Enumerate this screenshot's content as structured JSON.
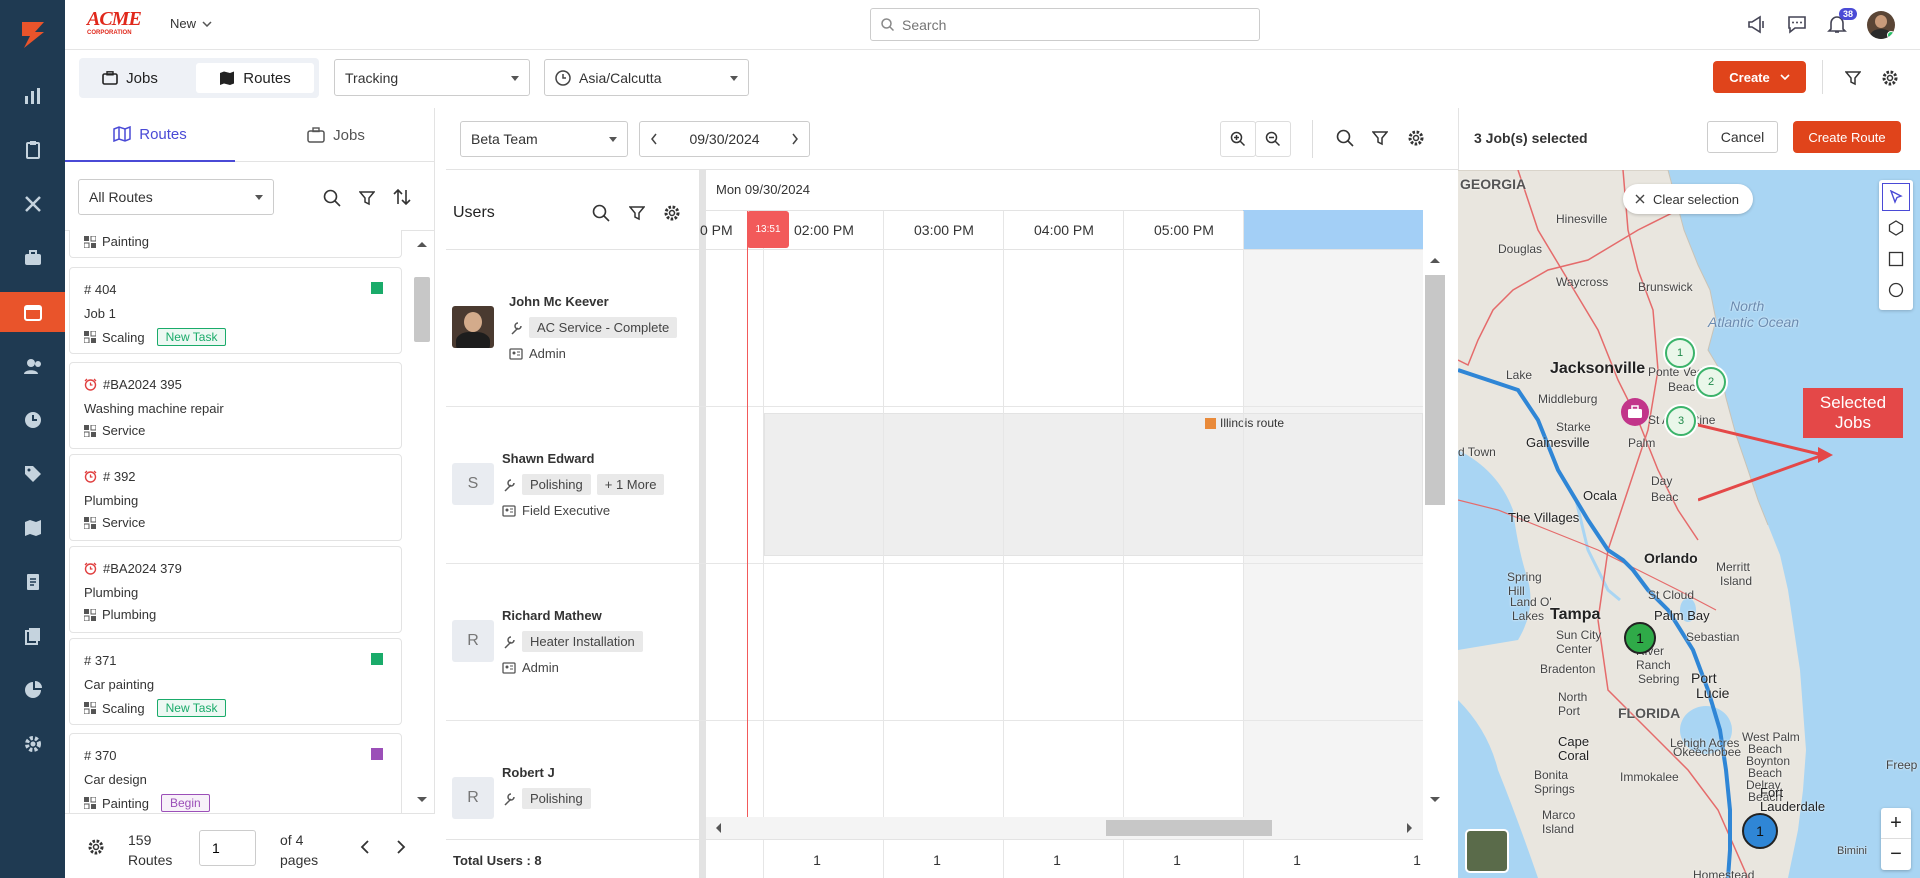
{
  "brand": {
    "logo_text": "ACME",
    "logo_sub": "CORPORATION",
    "new_label": "New"
  },
  "search": {
    "placeholder": "Search"
  },
  "notifications": {
    "count": "38"
  },
  "view_tabs": {
    "jobs": "Jobs",
    "routes": "Routes"
  },
  "tracking_select": "Tracking",
  "timezone_select": "Asia/Calcutta",
  "create_label": "Create",
  "left_panel": {
    "tabs": {
      "routes": "Routes",
      "jobs": "Jobs"
    },
    "filter_select": "All Routes",
    "partial_card_category": "Painting",
    "cards": [
      {
        "id": "# 404",
        "name": "Job 1",
        "category": "Scaling",
        "badge": "New Task",
        "badge_color": "#1aab6a",
        "square_color": "#1aab6a",
        "alarm": false
      },
      {
        "id": "#BA2024 395",
        "name": "Washing machine repair",
        "category": "Service",
        "badge": "",
        "alarm": true
      },
      {
        "id": "# 392",
        "name": "Plumbing",
        "category": "Service",
        "badge": "",
        "alarm": true
      },
      {
        "id": "#BA2024 379",
        "name": "Plumbing",
        "category": "Plumbing",
        "badge": "",
        "alarm": true
      },
      {
        "id": "# 371",
        "name": "Car painting",
        "category": "Scaling",
        "badge": "New Task",
        "badge_color": "#1aab6a",
        "square_color": "#1aab6a",
        "alarm": false
      },
      {
        "id": "# 370",
        "name": "Car design",
        "category": "Painting",
        "badge": "Begin",
        "badge_color": "#9b4fb8",
        "square_color": "#9b4fb8",
        "alarm": false
      }
    ],
    "footer": {
      "count": "159",
      "count_label": "Routes",
      "page_value": "1",
      "of_pages": "of 4",
      "pages_label": "pages"
    }
  },
  "schedule": {
    "team_select": "Beta Team",
    "date": "09/30/2024",
    "day_header": "Mon 09/30/2024",
    "now_marker": "13:51",
    "time_labels": [
      "0 PM",
      "02:00 PM",
      "03:00 PM",
      "04:00 PM",
      "05:00 PM"
    ],
    "users_title": "Users",
    "users": [
      {
        "name": "John Mc Keever",
        "skill": "AC Service - Complete",
        "more": "",
        "role": "Admin",
        "initial": ""
      },
      {
        "name": "Shawn Edward",
        "skill": "Polishing",
        "more": "+ 1 More",
        "role": "Field Executive",
        "initial": "S"
      },
      {
        "name": "Richard Mathew",
        "skill": "Heater Installation",
        "more": "",
        "role": "Admin",
        "initial": "R"
      },
      {
        "name": "Robert J",
        "skill": "Polishing",
        "more": "",
        "role": "",
        "initial": "R"
      }
    ],
    "route_label": "Illinois route",
    "route_color": "#e98a3a",
    "total_users": "Total Users : 8",
    "footer_counts": [
      "1",
      "1",
      "1",
      "1",
      "1",
      "1"
    ]
  },
  "map_panel": {
    "selected_text": "3 Job(s) selected",
    "cancel_label": "Cancel",
    "create_route_label": "Create Route",
    "clear_selection": "Clear selection",
    "callout": "Selected Jobs",
    "markers": [
      "1",
      "2",
      "3"
    ],
    "route_markers": [
      "1",
      "1"
    ],
    "zoom_in": "+",
    "zoom_out": "−",
    "places": [
      {
        "t": "GEORGIA"
      },
      {
        "t": "Hinesville"
      },
      {
        "t": "Douglas"
      },
      {
        "t": "Waycross"
      },
      {
        "t": "Brunswick"
      },
      {
        "t": "North"
      },
      {
        "t": "Atlantic Ocean"
      },
      {
        "t": "Jacksonville"
      },
      {
        "t": "Lake"
      },
      {
        "t": "Ponte Vedra"
      },
      {
        "t": "Beach"
      },
      {
        "t": "Middleburg"
      },
      {
        "t": "St Augustine"
      },
      {
        "t": "Starke"
      },
      {
        "t": "Gainesville"
      },
      {
        "t": "Palm"
      },
      {
        "t": "d Town"
      },
      {
        "t": "Ocala"
      },
      {
        "t": "Day"
      },
      {
        "t": "Beac"
      },
      {
        "t": "The Villages"
      },
      {
        "t": "Orlando"
      },
      {
        "t": "Merritt"
      },
      {
        "t": "Island"
      },
      {
        "t": "Spring"
      },
      {
        "t": "Hill"
      },
      {
        "t": "St Cloud"
      },
      {
        "t": "Land O'"
      },
      {
        "t": "Lakes"
      },
      {
        "t": "Palm Bay"
      },
      {
        "t": "Tampa"
      },
      {
        "t": "Sun City"
      },
      {
        "t": "Center"
      },
      {
        "t": "Sebastian"
      },
      {
        "t": "River"
      },
      {
        "t": "Ranch"
      },
      {
        "t": "Bradenton"
      },
      {
        "t": "Sebring"
      },
      {
        "t": "Port"
      },
      {
        "t": "Lucie"
      },
      {
        "t": "North"
      },
      {
        "t": "Port"
      },
      {
        "t": "FLORIDA"
      },
      {
        "t": "Cape"
      },
      {
        "t": "Coral"
      },
      {
        "t": "Lehigh Acres"
      },
      {
        "t": "Okeechobee"
      },
      {
        "t": "West Palm"
      },
      {
        "t": "Beach"
      },
      {
        "t": "Boynton"
      },
      {
        "t": "Beach"
      },
      {
        "t": "Delray"
      },
      {
        "t": "Beach"
      },
      {
        "t": "Bonita"
      },
      {
        "t": "Springs"
      },
      {
        "t": "Immokalee"
      },
      {
        "t": "Fort"
      },
      {
        "t": "Lauderdale"
      },
      {
        "t": "Marco"
      },
      {
        "t": "Island"
      },
      {
        "t": "Homestead"
      },
      {
        "t": "Bimini"
      },
      {
        "t": "Freep"
      }
    ]
  }
}
